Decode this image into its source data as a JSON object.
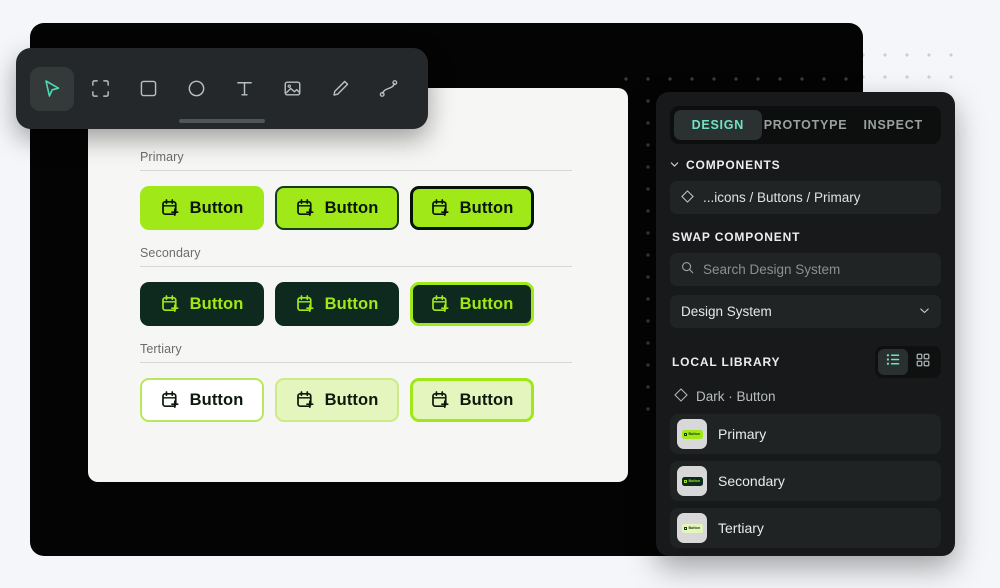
{
  "toolbar": {
    "name": "design-toolbar",
    "tools": [
      {
        "id": "move",
        "icon": "cursor-icon",
        "label": "Move",
        "active": true
      },
      {
        "id": "frame",
        "icon": "frame-icon",
        "label": "Frame",
        "active": false
      },
      {
        "id": "rectangle",
        "icon": "rectangle-icon",
        "label": "Rectangle",
        "active": false
      },
      {
        "id": "ellipse",
        "icon": "ellipse-icon",
        "label": "Ellipse",
        "active": false
      },
      {
        "id": "text",
        "icon": "text-icon",
        "label": "Text",
        "active": false
      },
      {
        "id": "image",
        "icon": "image-icon",
        "label": "Image",
        "active": false
      },
      {
        "id": "pen",
        "icon": "pen-icon",
        "label": "Pen",
        "active": false
      },
      {
        "id": "path",
        "icon": "path-icon",
        "label": "Path",
        "active": false
      }
    ]
  },
  "artboard": {
    "groups": [
      {
        "label": "Primary",
        "buttons": [
          {
            "label": "Button",
            "icon": "calendar-plus-icon",
            "variant": "p1"
          },
          {
            "label": "Button",
            "icon": "calendar-plus-icon",
            "variant": "p2"
          },
          {
            "label": "Button",
            "icon": "calendar-plus-icon",
            "variant": "p3"
          }
        ]
      },
      {
        "label": "Secondary",
        "buttons": [
          {
            "label": "Button",
            "icon": "calendar-plus-icon",
            "variant": "s1"
          },
          {
            "label": "Button",
            "icon": "calendar-plus-icon",
            "variant": "s2"
          },
          {
            "label": "Button",
            "icon": "calendar-plus-icon",
            "variant": "s3"
          }
        ]
      },
      {
        "label": "Tertiary",
        "buttons": [
          {
            "label": "Button",
            "icon": "calendar-plus-icon",
            "variant": "t1"
          },
          {
            "label": "Button",
            "icon": "calendar-plus-icon",
            "variant": "t2"
          },
          {
            "label": "Button",
            "icon": "calendar-plus-icon",
            "variant": "t3"
          }
        ]
      }
    ]
  },
  "panel": {
    "tabs": [
      {
        "label": "DESIGN",
        "active": true
      },
      {
        "label": "PROTOTYPE",
        "active": false
      },
      {
        "label": "INSPECT",
        "active": false
      }
    ],
    "components": {
      "section_label": "COMPONENTS",
      "selected": "...icons / Buttons / Primary",
      "icon": "diamond-component-icon",
      "chevron": "chevron-down-icon"
    },
    "swap": {
      "section_label": "SWAP COMPONENT",
      "search_placeholder": "Search Design System",
      "search_value": "",
      "search_icon": "search-icon",
      "select_value": "Design System",
      "select_chevron": "chevron-down-icon"
    },
    "library": {
      "section_label": "LOCAL LIBRARY",
      "view_list_icon": "list-view-icon",
      "view_grid_icon": "grid-view-icon",
      "view_active": "list",
      "group_label": "Dark · Button",
      "group_icon": "diamond-component-icon",
      "items": [
        {
          "name": "Primary",
          "thumb_bg": "#a0e817",
          "thumb_fg": "#123409"
        },
        {
          "name": "Secondary",
          "thumb_bg": "#0e2a1f",
          "thumb_fg": "#a0e817"
        },
        {
          "name": "Tertiary",
          "thumb_bg": "#e4f6bd",
          "thumb_fg": "#123409"
        }
      ]
    }
  },
  "colors": {
    "lime": "#a0e817",
    "dark_green": "#0e2a1f",
    "pale_lime": "#e4f6bd",
    "teal_accent": "#6fe3c4",
    "panel_bg": "#17191a",
    "card_bg": "#040404",
    "page_bg": "#f4f6f9"
  }
}
